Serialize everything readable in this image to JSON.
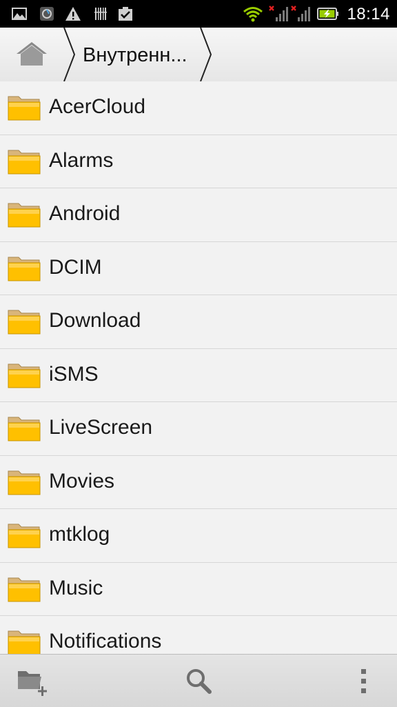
{
  "status_bar": {
    "time": "18:14",
    "icons": [
      "gallery-icon",
      "app-notification-icon",
      "warning-icon",
      "barcode-icon",
      "clipboard-check-icon",
      "wifi-icon",
      "signal-sim1-icon",
      "signal-sim2-icon",
      "battery-charging-icon"
    ]
  },
  "path_bar": {
    "home_icon": "home-icon",
    "current_folder": "Внутренн..."
  },
  "folders": [
    {
      "name": "AcerCloud"
    },
    {
      "name": "Alarms"
    },
    {
      "name": "Android"
    },
    {
      "name": "DCIM"
    },
    {
      "name": "Download"
    },
    {
      "name": "iSMS"
    },
    {
      "name": "LiveScreen"
    },
    {
      "name": "Movies"
    },
    {
      "name": "mtklog"
    },
    {
      "name": "Music"
    },
    {
      "name": "Notifications"
    }
  ],
  "bottom_bar": {
    "actions": [
      "new-folder-icon",
      "search-icon",
      "overflow-menu-icon"
    ]
  },
  "colors": {
    "folder_yellow": "#ffc000",
    "folder_tab": "#d9b57a",
    "accent_green": "#99cc00",
    "background": "#f2f2f2"
  }
}
